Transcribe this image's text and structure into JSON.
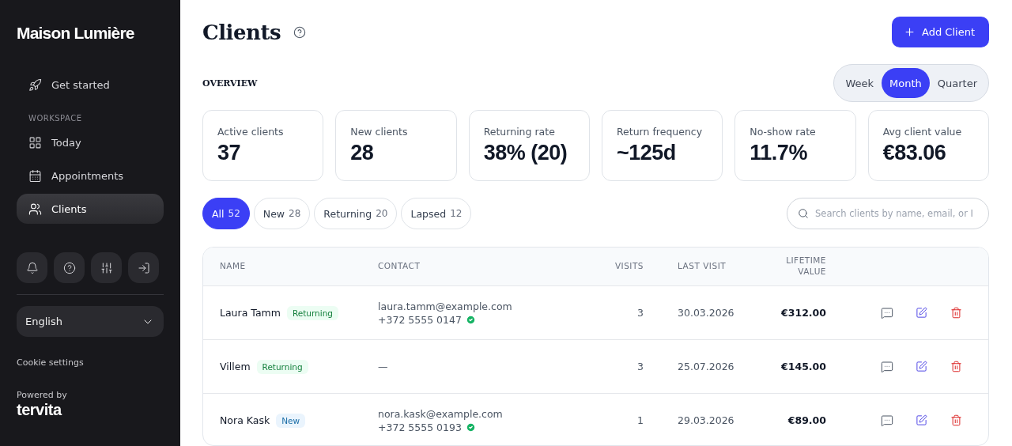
{
  "sidebar": {
    "brand": "Maison Lumière",
    "top_items": [
      {
        "label": "Get started",
        "selected": false
      }
    ],
    "section_label": "WORKSPACE",
    "items": [
      {
        "label": "Today",
        "selected": false
      },
      {
        "label": "Appointments",
        "selected": false
      },
      {
        "label": "Clients",
        "selected": true
      }
    ],
    "language": "English",
    "cookie_link": "Cookie settings",
    "powered_by": "Powered by",
    "powered_logo": "tervita"
  },
  "header": {
    "title": "Clients",
    "add_button": "Add Client"
  },
  "overview": {
    "label": "OVERVIEW",
    "periods": [
      {
        "label": "Week",
        "selected": false
      },
      {
        "label": "Month",
        "selected": true
      },
      {
        "label": "Quarter",
        "selected": false
      }
    ],
    "stats": [
      {
        "label": "Active clients",
        "value": "37"
      },
      {
        "label": "New clients",
        "value": "28"
      },
      {
        "label": "Returning rate",
        "value": "38% (20)"
      },
      {
        "label": "Return frequency",
        "value": "~125d"
      },
      {
        "label": "No-show rate",
        "value": "11.7%"
      },
      {
        "label": "Avg client value",
        "value": "€83.06"
      }
    ]
  },
  "filters": [
    {
      "label": "All",
      "count": "52",
      "selected": true
    },
    {
      "label": "New",
      "count": "28",
      "selected": false
    },
    {
      "label": "Returning",
      "count": "20",
      "selected": false
    },
    {
      "label": "Lapsed",
      "count": "12",
      "selected": false
    }
  ],
  "search": {
    "placeholder": "Search clients by name, email, or I"
  },
  "table": {
    "columns": [
      "NAME",
      "CONTACT",
      "VISITS",
      "LAST VISIT",
      "LIFETIME VALUE"
    ],
    "rows": [
      {
        "name": "Laura Tamm",
        "tag": {
          "kind": "returning",
          "label": "Returning"
        },
        "contact": {
          "kind": "full",
          "email": "laura.tamm@example.com",
          "phone": "+372 5555 0147",
          "verified": true
        },
        "visits": "3",
        "last_visit": "30.03.2026",
        "lifetime_value": "€312.00"
      },
      {
        "name": "Villem",
        "tag": {
          "kind": "returning",
          "label": "Returning"
        },
        "contact": {
          "kind": "none",
          "text": "—"
        },
        "visits": "3",
        "last_visit": "25.07.2026",
        "lifetime_value": "€145.00"
      },
      {
        "name": "Nora Kask",
        "tag": {
          "kind": "new",
          "label": "New"
        },
        "contact": {
          "kind": "full",
          "email": "nora.kask@example.com",
          "phone": "+372 5555 0193",
          "verified": true
        },
        "visits": "1",
        "last_visit": "29.03.2026",
        "lifetime_value": "€89.00"
      }
    ]
  }
}
